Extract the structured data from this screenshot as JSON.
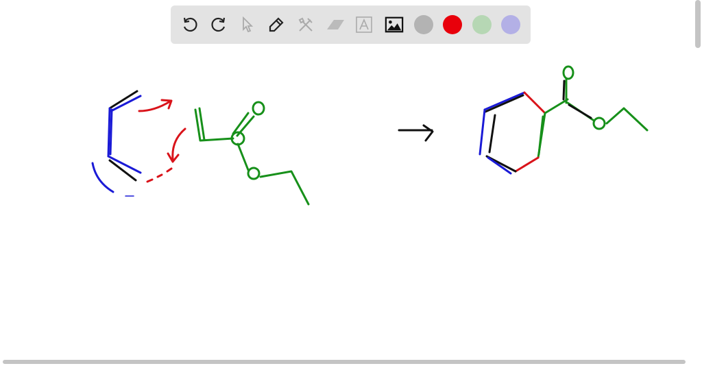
{
  "toolbar": {
    "tools": [
      "undo-icon",
      "redo-icon",
      "select-icon",
      "pen-icon",
      "tools-icon",
      "eraser-icon",
      "text-icon",
      "image-icon"
    ],
    "colors": {
      "gray": "#b3b3b3",
      "red": "#e8000b",
      "green": "#b6d7b4",
      "purple": "#b3b0e6"
    }
  },
  "drawing": {
    "colors": {
      "black": "#111111",
      "blue": "#1a1ad6",
      "green": "#17901a",
      "red": "#d9131a"
    }
  }
}
